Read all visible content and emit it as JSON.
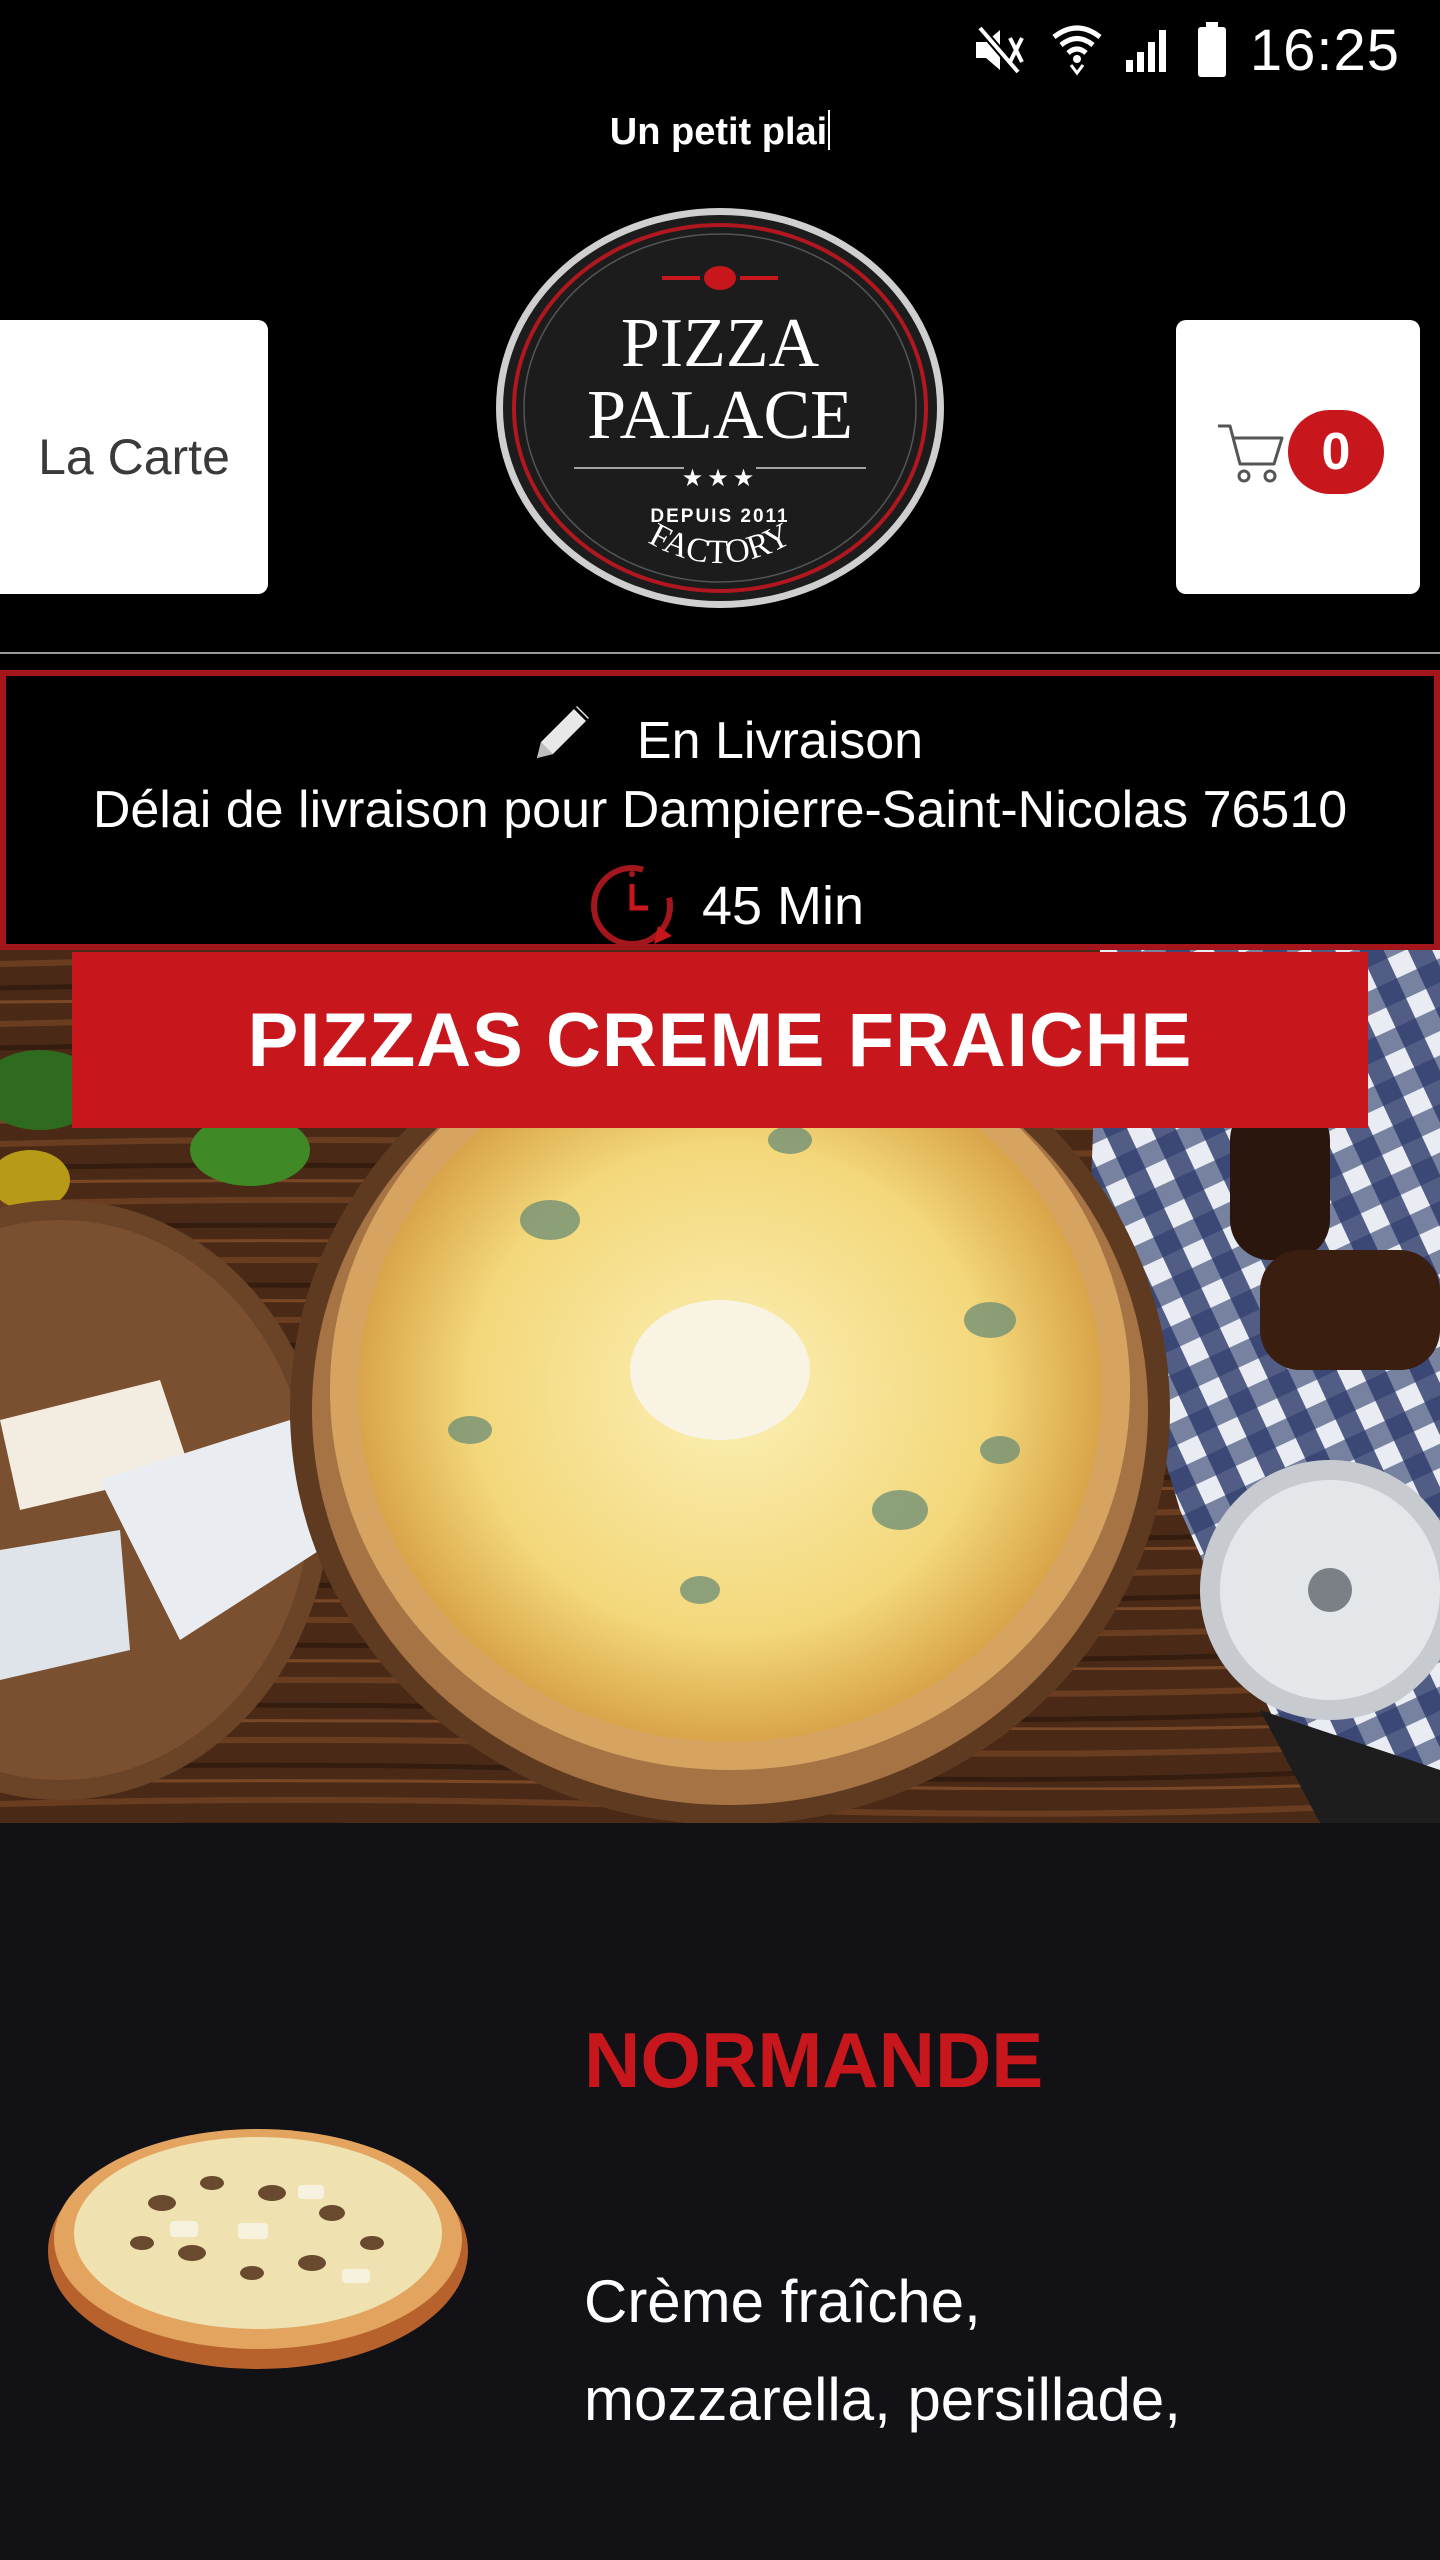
{
  "status_bar": {
    "time": "16:25",
    "icons": [
      "mute-icon",
      "wifi-icon",
      "signal-icon",
      "battery-icon"
    ]
  },
  "ticker": {
    "text": "Un petit plai"
  },
  "header": {
    "menu_label": "La Carte",
    "cart_count": "0",
    "logo": {
      "line1": "PIZZA",
      "line2": "PALACE",
      "stars": "★★★",
      "since": "DEPUIS 2011",
      "sub": "FACTORY"
    }
  },
  "delivery": {
    "mode": "En Livraison",
    "info": "Délai de livraison pour Dampierre-Saint-Nicolas 76510",
    "time": "45 Min"
  },
  "category": {
    "title": "PIZZAS CREME FRAICHE"
  },
  "product": {
    "name": "NORMANDE",
    "description": "Crème fraîche, mozzarella, persillade,"
  },
  "colors": {
    "accent": "#c8161d",
    "background": "#000000",
    "section_bg": "#111116"
  }
}
